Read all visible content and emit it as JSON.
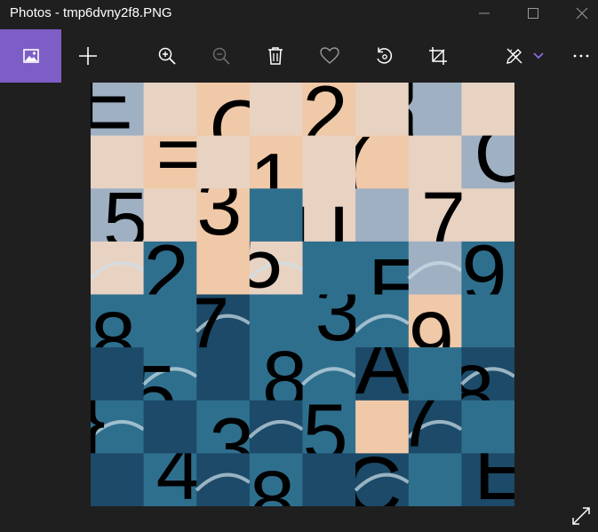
{
  "window": {
    "title": "Photos - tmp6dvny2f8.PNG",
    "controls": [
      "minimize-icon",
      "maximize-icon",
      "close-icon"
    ]
  },
  "toolbar": {
    "accent_color": "#7d5ec6",
    "buttons": [
      {
        "name": "view-image-button",
        "icon": "image-icon",
        "active": true
      },
      {
        "name": "add-button",
        "icon": "plus-icon"
      },
      {
        "name": "zoom-in-button",
        "icon": "zoom-in-icon"
      },
      {
        "name": "zoom-out-button",
        "icon": "zoom-out-icon",
        "disabled": true
      },
      {
        "name": "delete-button",
        "icon": "trash-icon"
      },
      {
        "name": "favorite-button",
        "icon": "heart-icon"
      },
      {
        "name": "rotate-button",
        "icon": "rotate-icon"
      },
      {
        "name": "crop-button",
        "icon": "crop-icon"
      },
      {
        "name": "edit-draw-button",
        "icon": "pen-ruler-icon"
      },
      {
        "name": "edit-dropdown-button",
        "icon": "chevron-down-icon"
      },
      {
        "name": "more-button",
        "icon": "ellipsis-icon"
      }
    ]
  },
  "image": {
    "description_colors": {
      "sky_light": "#e8d2c2",
      "sky_blue": "#9fb0c2",
      "cloud_peach": "#f0c9a8",
      "wave_dark": "#1c4a68",
      "wave_mid": "#2f6f8e",
      "foam": "#cfe0e8"
    },
    "glyphs": [
      "E",
      "C",
      "2",
      "{",
      "=",
      "1",
      "(",
      "C",
      "5",
      "3",
      "U",
      "7",
      "2",
      "5",
      "E",
      "9",
      "8",
      "7",
      "3",
      "9",
      "5",
      "8",
      "A",
      "8",
      "}",
      "3",
      "5",
      "7",
      "4",
      "8",
      "C",
      "E"
    ]
  },
  "footer": {
    "expand_icon": "fullscreen-icon"
  }
}
